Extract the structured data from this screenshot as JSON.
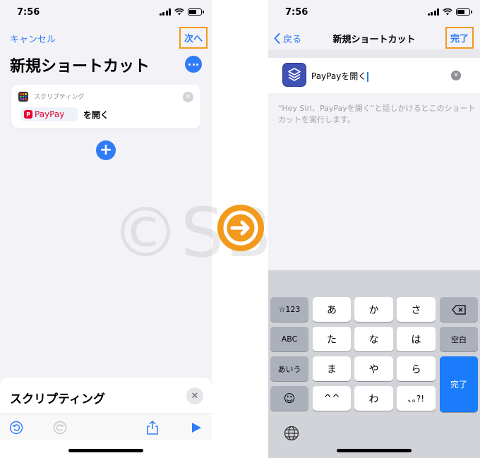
{
  "status": {
    "time": "7:56"
  },
  "left_screen": {
    "nav": {
      "cancel": "キャンセル",
      "next": "次へ"
    },
    "title": "新規ショートカット",
    "action_card": {
      "category": "スクリプティング",
      "app_name": "PayPay",
      "verb": "を開く"
    },
    "bottom_sheet": {
      "title": "スクリプティング"
    },
    "toolbar": {
      "icons": [
        "undo-icon",
        "redo-icon",
        "share-icon",
        "play-icon"
      ]
    }
  },
  "right_screen": {
    "nav": {
      "back": "戻る",
      "title": "新規ショートカット",
      "done": "完了"
    },
    "name_field": {
      "value": "PayPayを開く"
    },
    "hint": "“Hey Siri、PayPayを開く”と話しかけるとこのショートカットを実行します。",
    "keyboard": {
      "rows": [
        [
          "☆123",
          "あ",
          "か",
          "さ",
          "⌫"
        ],
        [
          "ABC",
          "た",
          "な",
          "は",
          "空白"
        ],
        [
          "あいう",
          "ま",
          "や",
          "ら",
          "完了"
        ],
        [
          "☺",
          "^^",
          "わ",
          "､｡?!"
        ]
      ]
    }
  },
  "watermark": "©SBAPP",
  "colors": {
    "accent": "#2f7cf6",
    "highlight": "#f39a1c",
    "paypay": "#e8002e"
  }
}
